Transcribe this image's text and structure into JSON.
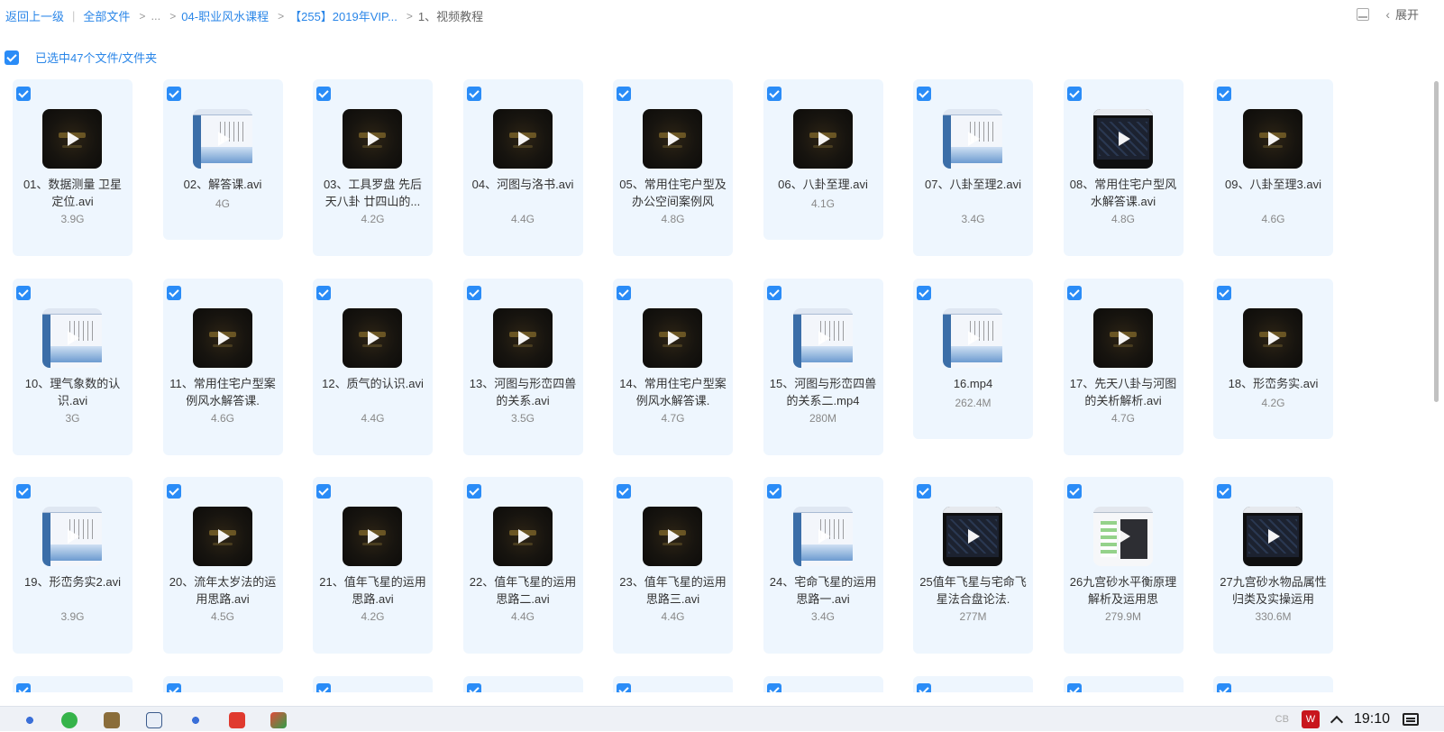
{
  "breadcrumb": {
    "back": "返回上一级",
    "root": "全部文件",
    "ellipsis": "...",
    "level1": "04-职业风水课程",
    "level2": "【255】2019年VIP...",
    "current": "1、视频教程"
  },
  "toolbar": {
    "expand_label": "展开",
    "list_icon": "list-view-icon",
    "chevron_icon": "chevron-left-icon"
  },
  "selection": {
    "label": "已选中47个文件/文件夹"
  },
  "colors": {
    "accent": "#2a86e8",
    "card_bg": "#eef6fe",
    "checkbox": "#2a8cf7"
  },
  "files": [
    {
      "name": "01、数据测量 卫星定位.avi",
      "size": "3.9G",
      "thumb": "dark"
    },
    {
      "name": "02、解答课.avi",
      "size": "4G",
      "thumb": "shot"
    },
    {
      "name": "03、工具罗盘 先后天八卦 廿四山的...",
      "size": "4.2G",
      "thumb": "dark"
    },
    {
      "name": "04、河图与洛书.avi",
      "size": "4.4G",
      "thumb": "dark"
    },
    {
      "name": "05、常用住宅户型及办公空间案例风",
      "size": "4.8G",
      "thumb": "dark"
    },
    {
      "name": "06、八卦至理.avi",
      "size": "4.1G",
      "thumb": "dark"
    },
    {
      "name": "07、八卦至理2.avi",
      "size": "3.4G",
      "thumb": "shot"
    },
    {
      "name": "08、常用住宅户型风水解答课.avi",
      "size": "4.8G",
      "thumb": "black"
    },
    {
      "name": "09、八卦至理3.avi",
      "size": "4.6G",
      "thumb": "dark"
    },
    {
      "name": "10、理气象数的认识.avi",
      "size": "3G",
      "thumb": "shot"
    },
    {
      "name": "11、常用住宅户型案例风水解答课.",
      "size": "4.6G",
      "thumb": "dark"
    },
    {
      "name": "12、质气的认识.avi",
      "size": "4.4G",
      "thumb": "dark"
    },
    {
      "name": "13、河图与形峦四兽的关系.avi",
      "size": "3.5G",
      "thumb": "dark"
    },
    {
      "name": "14、常用住宅户型案例风水解答课.",
      "size": "4.7G",
      "thumb": "dark"
    },
    {
      "name": "15、河图与形峦四兽的关系二.mp4",
      "size": "280M",
      "thumb": "shot"
    },
    {
      "name": "16.mp4",
      "size": "262.4M",
      "thumb": "shot"
    },
    {
      "name": "17、先天八卦与河图的关析解析.avi",
      "size": "4.7G",
      "thumb": "dark"
    },
    {
      "name": "18、形峦务实.avi",
      "size": "4.2G",
      "thumb": "dark"
    },
    {
      "name": "19、形峦务实2.avi",
      "size": "3.9G",
      "thumb": "shot"
    },
    {
      "name": "20、流年太岁法的运用思路.avi",
      "size": "4.5G",
      "thumb": "dark"
    },
    {
      "name": "21、值年飞星的运用思路.avi",
      "size": "4.2G",
      "thumb": "dark"
    },
    {
      "name": "22、值年飞星的运用思路二.avi",
      "size": "4.4G",
      "thumb": "dark"
    },
    {
      "name": "23、值年飞星的运用思路三.avi",
      "size": "4.4G",
      "thumb": "dark"
    },
    {
      "name": "24、宅命飞星的运用思路一.avi",
      "size": "3.4G",
      "thumb": "shot"
    },
    {
      "name": "25值年飞星与宅命飞星法合盘论法.",
      "size": "277M",
      "thumb": "black"
    },
    {
      "name": "26九宫砂水平衡原理解析及运用思",
      "size": "279.9M",
      "thumb": "mix"
    },
    {
      "name": "27九宫砂水物品属性归类及实操运用",
      "size": "330.6M",
      "thumb": "black"
    }
  ],
  "taskbar": {
    "time": "19:10",
    "ime": "CB",
    "logo_text": "W",
    "icons": [
      "app-cluster-icon",
      "wechat-icon",
      "file-manager-icon",
      "notepad-icon",
      "app-cluster-icon-2",
      "wps-icon",
      "media-icon"
    ]
  }
}
